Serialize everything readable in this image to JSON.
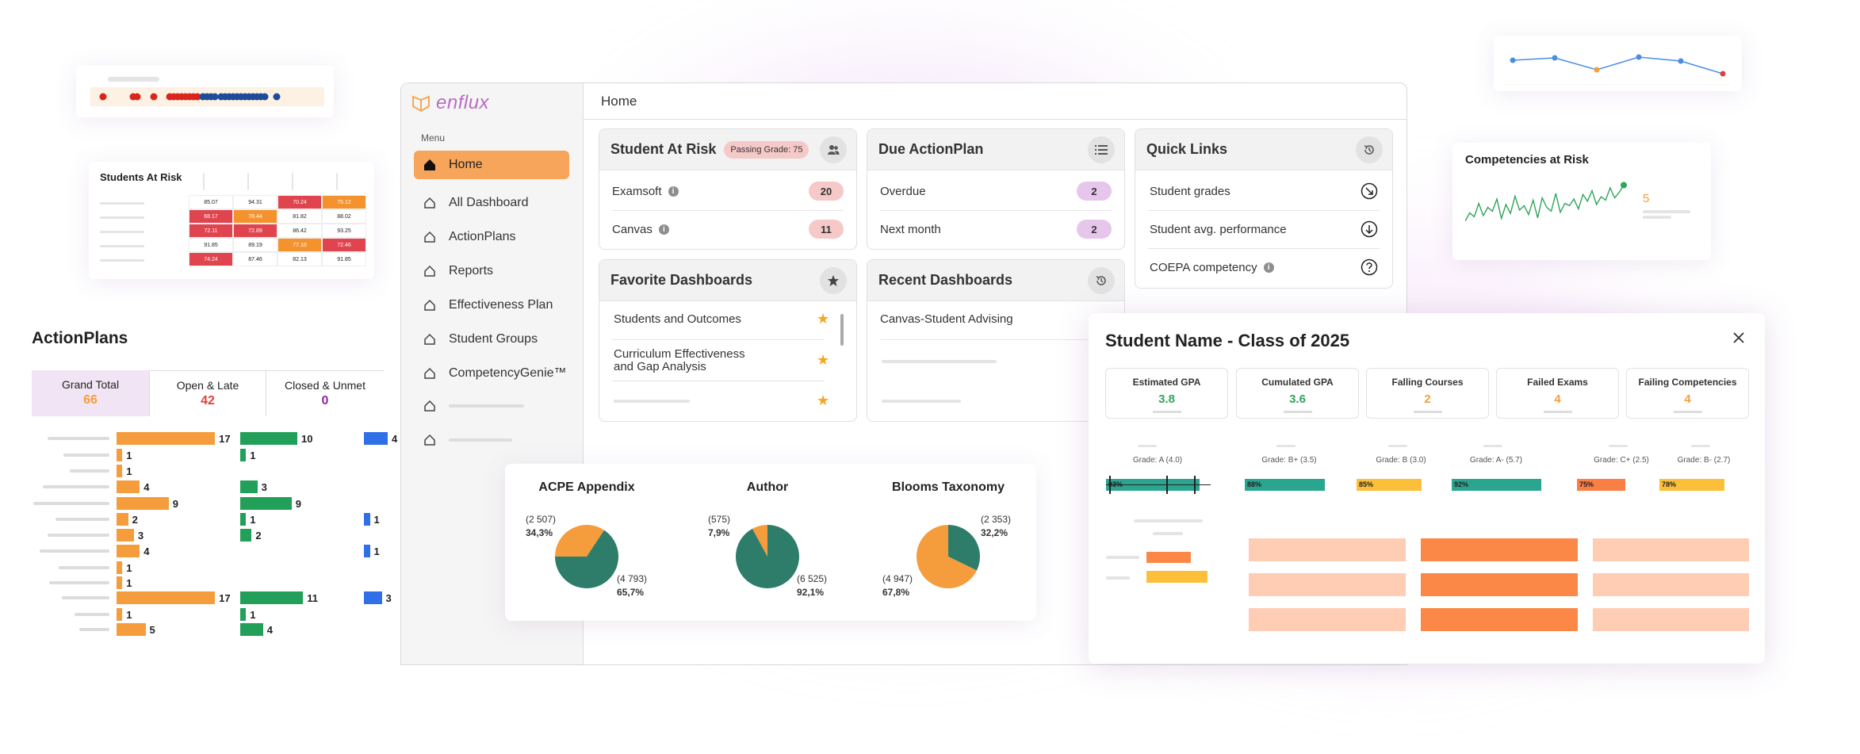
{
  "app": {
    "logo_text": "enflux",
    "breadcrumb": "Home",
    "menu_heading": "Menu",
    "nav": [
      {
        "label": "Home",
        "active": true
      },
      {
        "label": "All Dashboard"
      },
      {
        "label": "ActionPlans"
      },
      {
        "label": "Reports"
      },
      {
        "label": "Effectiveness Plan"
      },
      {
        "label": "Student Groups"
      },
      {
        "label": "CompetencyGenie™"
      }
    ]
  },
  "student_at_risk": {
    "title": "Student At Risk",
    "badge": "Passing Grade: 75",
    "rows": [
      {
        "label": "Examsoft",
        "value": "20"
      },
      {
        "label": "Canvas",
        "value": "11"
      }
    ]
  },
  "due_actionplan": {
    "title": "Due ActionPlan",
    "rows": [
      {
        "label": "Overdue",
        "value": "2"
      },
      {
        "label": "Next month",
        "value": "2"
      }
    ]
  },
  "quick_links": {
    "title": "Quick Links",
    "rows": [
      {
        "label": "Student grades"
      },
      {
        "label": "Student avg. performance"
      },
      {
        "label": "COEPA competency"
      }
    ]
  },
  "favorite_dashboards": {
    "title": "Favorite Dashboards",
    "items": [
      "Students and Outcomes",
      "Curriculum Effectiveness\nand Gap Analysis"
    ]
  },
  "recent_dashboards": {
    "title": "Recent Dashboards",
    "items": [
      "Canvas-Student Advising"
    ]
  },
  "pies": [
    {
      "title": "ACPE Appendix",
      "slices": [
        {
          "count": "(2 507)",
          "pct": "34,3%",
          "value": 34.3,
          "color": "#f59d3d"
        },
        {
          "count": "(4 793)",
          "pct": "65,7%",
          "value": 65.7,
          "color": "#2e7d6b"
        }
      ]
    },
    {
      "title": "Author",
      "slices": [
        {
          "count": "(575)",
          "pct": "7,9%",
          "value": 7.9,
          "color": "#f59d3d"
        },
        {
          "count": "(6 525)",
          "pct": "92,1%",
          "value": 92.1,
          "color": "#2e7d6b"
        }
      ]
    },
    {
      "title": "Blooms Taxonomy",
      "slices": [
        {
          "count": "(2 353)",
          "pct": "32,2%",
          "value": 32.2,
          "color": "#2e7d6b"
        },
        {
          "count": "(4 947)",
          "pct": "67,8%",
          "value": 67.8,
          "color": "#f59d3d"
        }
      ]
    }
  ],
  "student_modal": {
    "title": "Student Name - Class of 2025",
    "metrics": [
      {
        "label": "Estimated GPA",
        "value": "3.8",
        "color": "#2ea55a"
      },
      {
        "label": "Cumulated GPA",
        "value": "3.6",
        "color": "#2ea55a"
      },
      {
        "label": "Falling Courses",
        "value": "2",
        "color": "#f59d3d"
      },
      {
        "label": "Failed Exams",
        "value": "4",
        "color": "#f59d3d"
      },
      {
        "label": "Failing Competencies",
        "value": "4",
        "color": "#f59d3d"
      }
    ],
    "grades": [
      {
        "label": "Grade: A (4.0)",
        "pct": "93%",
        "value": 93,
        "color": "#2aa58f"
      },
      {
        "label": "Grade: B+ (3.5)",
        "pct": "88%",
        "value": 88,
        "color": "#2aa58f"
      },
      {
        "label": "Grade: B (3.0)",
        "pct": "85%",
        "value": 85,
        "color": "#fbbf3a"
      },
      {
        "label": "Grade: A- (5.7)",
        "pct": "92%",
        "value": 92,
        "color": "#2aa58f"
      },
      {
        "label": "Grade: C+ (2.5)",
        "pct": "75%",
        "value": 75,
        "color": "#fb7e45"
      },
      {
        "label": "Grade: B- (2.7)",
        "pct": "78%",
        "value": 78,
        "color": "#fbbf3a"
      }
    ]
  },
  "action_plans": {
    "title": "ActionPlans",
    "tabs": [
      {
        "label": "Grand Total",
        "value": "66",
        "color": "#f59d3d"
      },
      {
        "label": "Open & Late",
        "value": "42",
        "color": "#e0403b"
      },
      {
        "label": "Closed & Unmet",
        "value": "0",
        "color": "#8a2aa0"
      }
    ],
    "orange": [
      17,
      1,
      1,
      4,
      9,
      2,
      3,
      4,
      1,
      1,
      17,
      1,
      5
    ],
    "green": [
      10,
      1,
      null,
      3,
      9,
      1,
      2,
      null,
      null,
      null,
      11,
      1,
      4
    ],
    "blue": [
      4,
      null,
      null,
      null,
      null,
      1,
      null,
      1,
      null,
      null,
      3,
      null,
      null
    ],
    "colors": {
      "orange": "#f59d3d",
      "green": "#22a05a",
      "blue": "#2f6fe8"
    }
  },
  "students_at_risk_table": {
    "title": "Students At Risk",
    "rows": [
      [
        "85.07",
        "94.31",
        "70.24",
        "75.12"
      ],
      [
        "68.17",
        "78.44",
        "81.82",
        "88.02"
      ],
      [
        "72.11",
        "72.89",
        "86.42",
        "93.25"
      ],
      [
        "91.85",
        "89.19",
        "77.10",
        "72.46"
      ],
      [
        "74.24",
        "87.46",
        "82.13",
        "91.85"
      ]
    ],
    "highlight": [
      [
        null,
        null,
        "red",
        "orange"
      ],
      [
        "red",
        "orange",
        null,
        null
      ],
      [
        "red",
        "red",
        null,
        null
      ],
      [
        null,
        null,
        "orange",
        "red"
      ],
      [
        "red",
        null,
        null,
        null
      ]
    ]
  },
  "competencies": {
    "title": "Competencies at Risk",
    "value": "5",
    "series": [
      30,
      45,
      38,
      62,
      40,
      55,
      48,
      70,
      35,
      60,
      44,
      75,
      50,
      58,
      42,
      68,
      36,
      72,
      55,
      48,
      80,
      46,
      62,
      58,
      70,
      52,
      78,
      66,
      85,
      60,
      74,
      68,
      90,
      72,
      82,
      95
    ]
  },
  "line_widget": {
    "values": [
      62,
      68,
      38,
      70,
      60,
      28
    ]
  },
  "dots": {
    "colors": [
      "red",
      "red",
      "red",
      "red",
      "red",
      "red",
      "red",
      "red",
      "red",
      "red",
      "blue",
      "blue",
      "blue",
      "blue",
      "blue",
      "blue",
      "blue",
      "blue",
      "blue",
      "blue",
      "blue",
      "blue",
      "blue",
      "blue"
    ]
  }
}
